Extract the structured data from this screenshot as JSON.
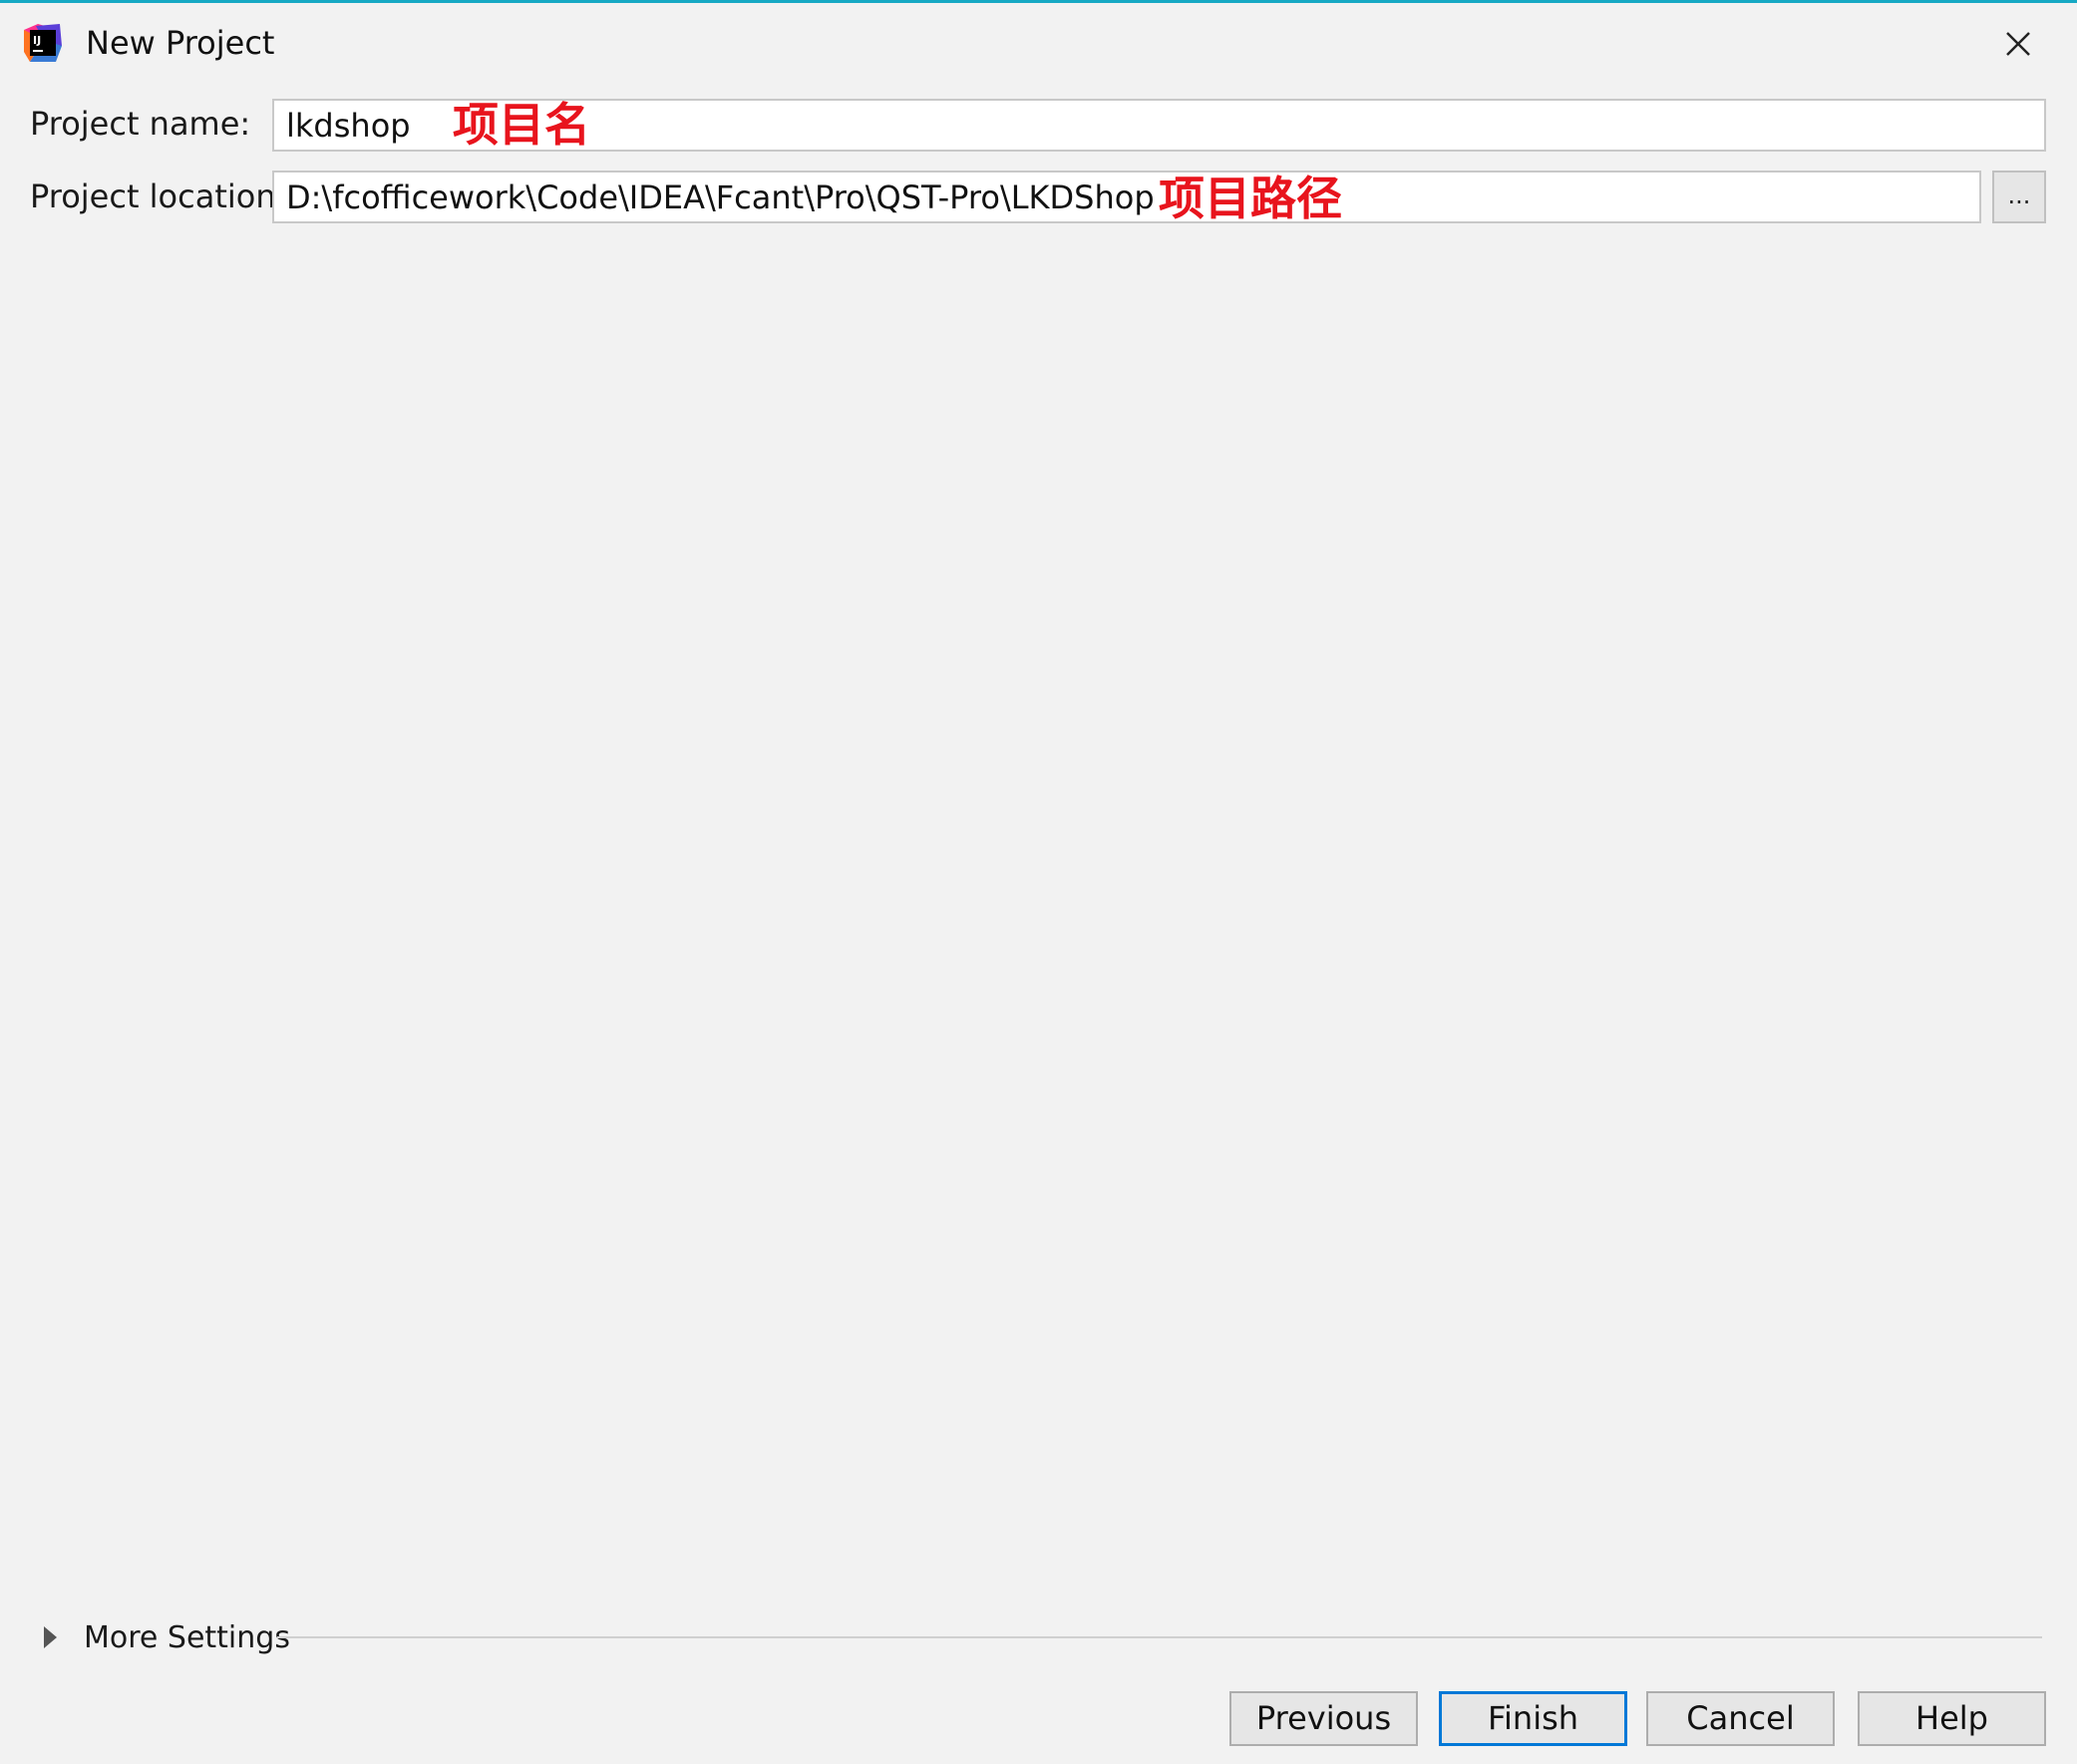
{
  "window": {
    "title": "New Project",
    "accent_color": "#17a9c4"
  },
  "icons": {
    "app": "intellij-idea-icon",
    "close": "close-icon",
    "expand": "triangle-right-icon"
  },
  "form": {
    "name_label": "Project name:",
    "name_value": "lkdshop",
    "location_label": "Project location:",
    "location_value": "D:\\fcofficework\\Code\\IDEA\\Fcant\\Pro\\QST-Pro\\LKDShop",
    "browse_label": "..."
  },
  "annotations": {
    "name_note": "项目名",
    "location_note": "项目路径",
    "color": "#e8141d"
  },
  "more_settings": {
    "label": "More Settings"
  },
  "buttons": {
    "previous": "Previous",
    "finish": "Finish",
    "cancel": "Cancel",
    "help": "Help",
    "focus_color": "#0078d7"
  }
}
